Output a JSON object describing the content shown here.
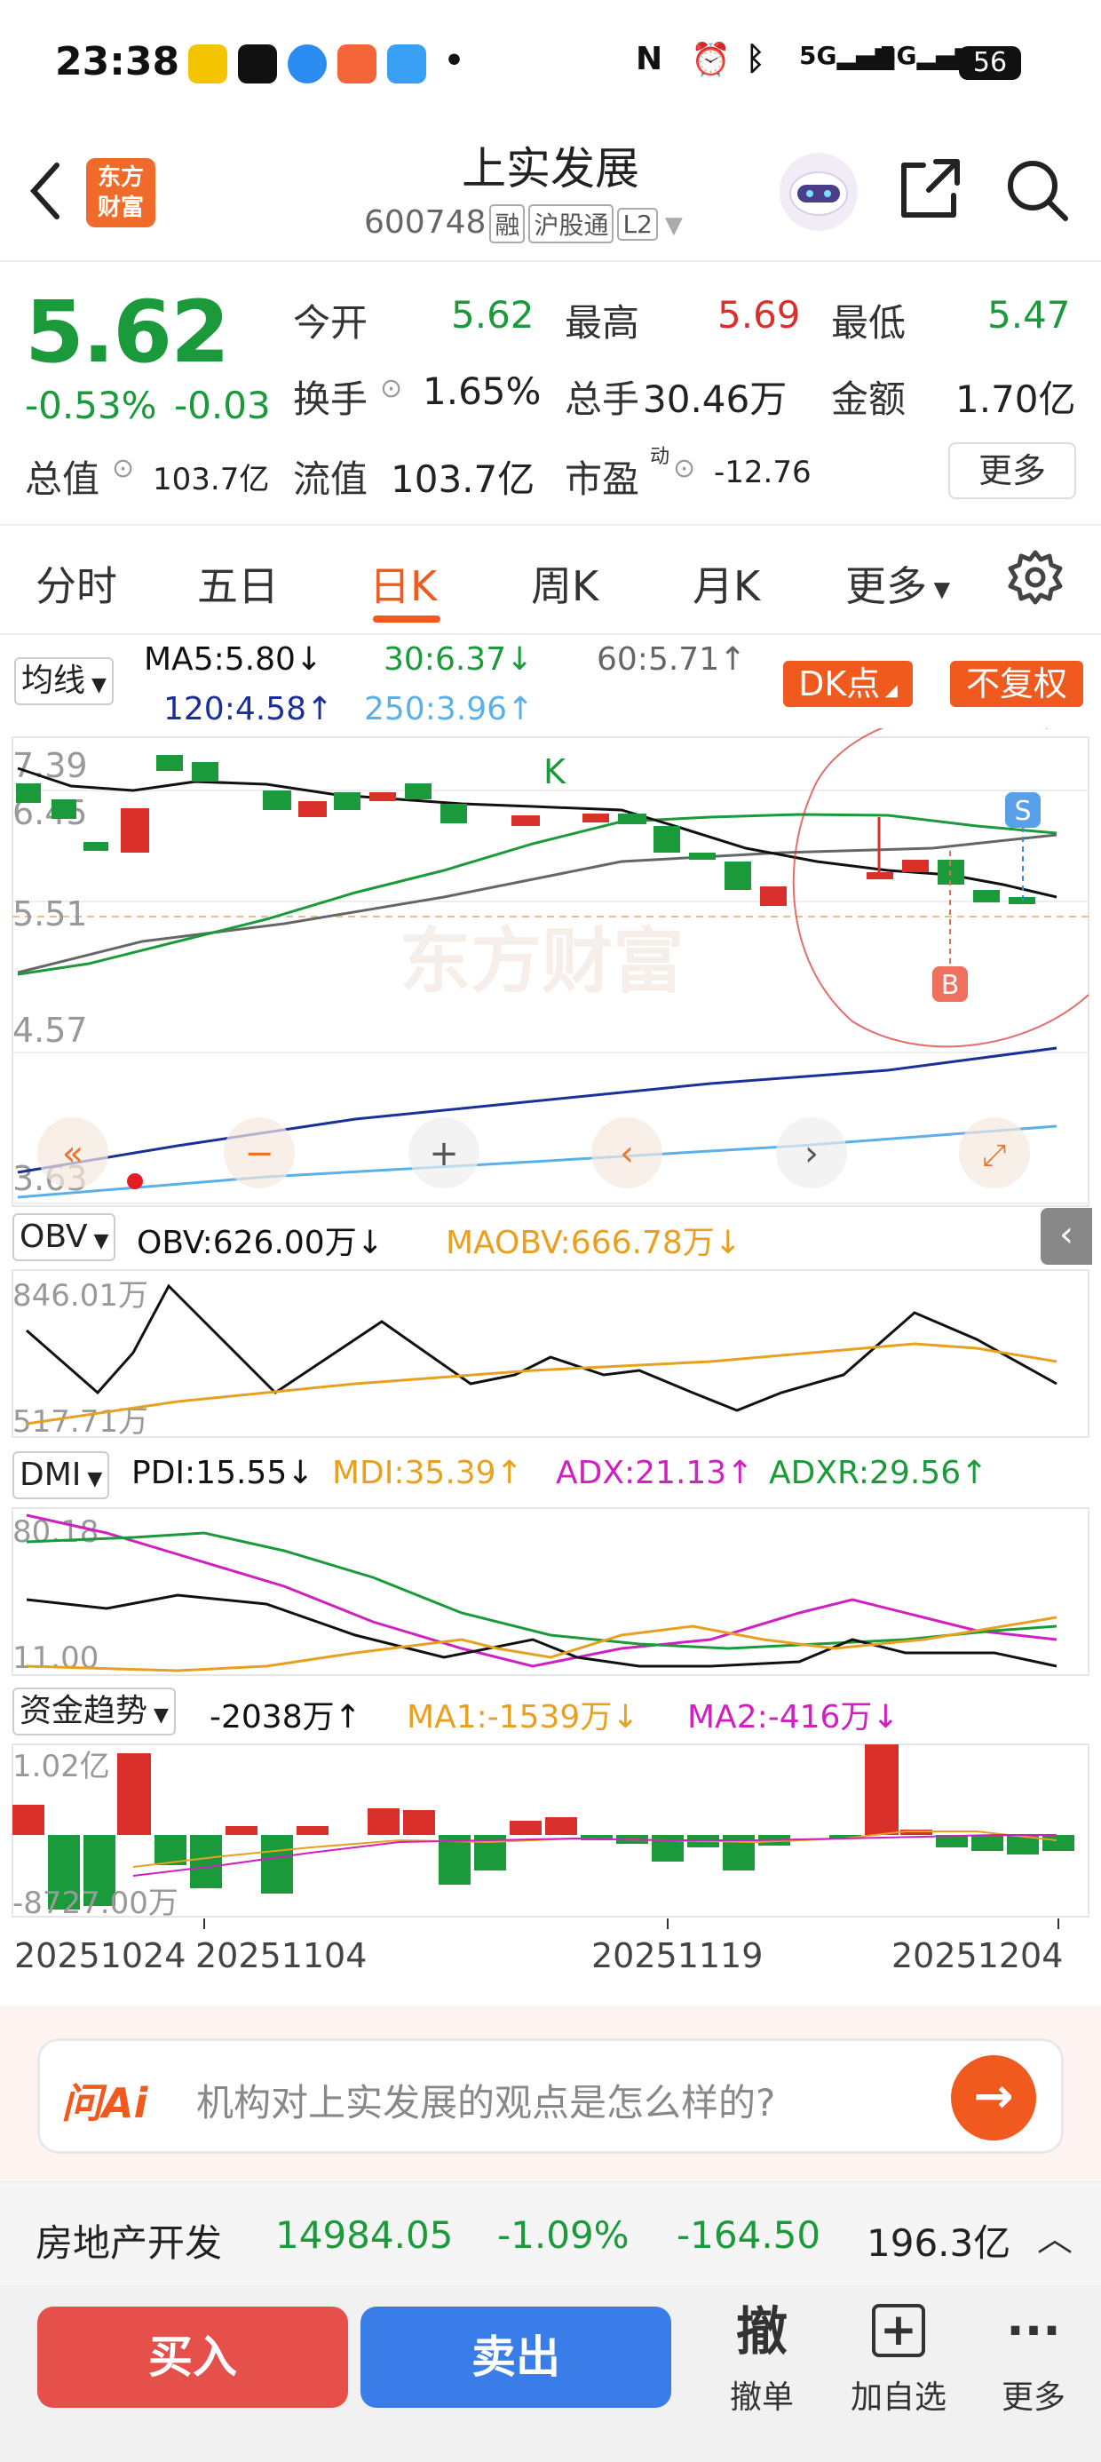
{
  "status": {
    "time": "23:38",
    "net": "5G",
    "battery": "56"
  },
  "header": {
    "title": "上实发展",
    "code": "600748",
    "tags": [
      "融",
      "沪股通",
      "L2"
    ],
    "logo_text": [
      "东方",
      "财富"
    ]
  },
  "quote": {
    "price": "5.62",
    "pct": "-0.53%",
    "chg": "-0.03",
    "open_label": "今开",
    "open": "5.62",
    "high_label": "最高",
    "high": "5.69",
    "low_label": "最低",
    "low": "5.47",
    "turnover_label": "换手",
    "turnover": "1.65%",
    "vol_label": "总手",
    "vol": "30.46万",
    "amount_label": "金额",
    "amount": "1.70亿",
    "mktcap_label": "总值",
    "mktcap": "103.7亿",
    "float_label": "流值",
    "float": "103.7亿",
    "pe_label": "市盈",
    "pe_sup": "动",
    "pe": "-12.76",
    "more": "更多"
  },
  "tabs": [
    "分时",
    "五日",
    "日K",
    "周K",
    "月K",
    "更多"
  ],
  "active_tab": 2,
  "ma": {
    "selector": "均线",
    "ma5": "MA5:5.80↓",
    "ma30": "30:6.37↓",
    "ma60": "60:5.71↑",
    "ma120": "120:4.58↑",
    "ma250": "250:3.96↑",
    "dk": "DK点",
    "fq": "不复权"
  },
  "kline": {
    "ticks": [
      "7.39",
      "6.45",
      "5.51",
      "4.57",
      "3.63"
    ],
    "k_mark": "K",
    "s_mark": "S",
    "b_mark": "B",
    "watermark": "东方财富"
  },
  "obv": {
    "selector": "OBV",
    "obv": "OBV:626.00万↓",
    "maobv": "MAOBV:666.78万↓",
    "top": "846.01万",
    "bottom": "517.71万"
  },
  "dmi": {
    "selector": "DMI",
    "pdi": "PDI:15.55↓",
    "mdi": "MDI:35.39↑",
    "adx": "ADX:21.13↑",
    "adxr": "ADXR:29.56↑",
    "top": "80.18",
    "bottom": "11.00"
  },
  "fund": {
    "selector": "资金趋势",
    "val": "-2038万↑",
    "ma1": "MA1:-1539万↓",
    "ma2": "MA2:-416万↓",
    "top": "1.02亿",
    "bottom": "-8727.00万"
  },
  "dates": [
    "20251024",
    "20251104",
    "20251119",
    "20251204"
  ],
  "ask": {
    "brand": "问Ai",
    "text": "机构对上实发展的观点是怎么样的?"
  },
  "sector": {
    "name": "房地产开发",
    "index": "14984.05",
    "pct": "-1.09%",
    "chg": "-164.50",
    "amount": "196.3亿"
  },
  "actions": {
    "buy": "买入",
    "sell": "卖出",
    "cancel_icon": "撤",
    "cancel": "撤单",
    "add": "加自选",
    "more": "更多"
  },
  "colors": {
    "up": "#d9302c",
    "down": "#1a9a3a",
    "accent": "#f05a1e",
    "ma5": "#111111",
    "ma30": "#1a9a3a",
    "ma60": "#666666",
    "ma120": "#1a2f9a",
    "ma250": "#5ab0e8"
  }
}
